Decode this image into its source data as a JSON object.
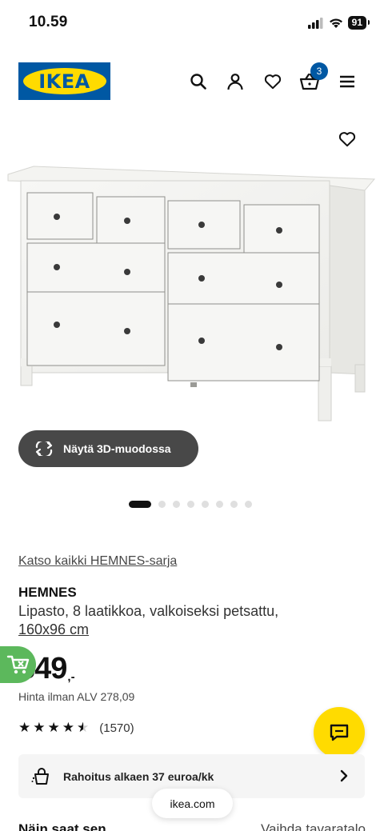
{
  "status": {
    "time": "10.59",
    "battery": "91"
  },
  "header": {
    "logo_text": "IKEA",
    "cart_count": "3",
    "icons": [
      "search-icon",
      "user-icon",
      "heart-icon",
      "basket-icon",
      "menu-icon"
    ]
  },
  "gallery": {
    "btn_3d_label": "Näytä 3D-muodossa",
    "image_count": 8,
    "active_image": 1
  },
  "product": {
    "series_link": "Katso kaikki HEMNES-sarja",
    "name": "HEMNES",
    "description": "Lipasto, 8 laatikkoa, valkoiseksi petsattu,",
    "size": "160x96 cm",
    "price_int": "349",
    "price_suffix": ",-",
    "vat_text": "Hinta ilman ALV 278,09",
    "rating": 4.5,
    "review_count": "(1570)"
  },
  "finance": {
    "label": "Rahoitus alkaen 37 euroa/kk"
  },
  "browser": {
    "url": "ikea.com"
  },
  "bottom": {
    "left_text": "Näin saat sen",
    "right_text": "Vaihda tavaratalo"
  },
  "colors": {
    "ikea_blue": "#0058a3",
    "ikea_yellow": "#ffdb00",
    "cart_green": "#5cb85c",
    "btn_dark": "#484848"
  }
}
